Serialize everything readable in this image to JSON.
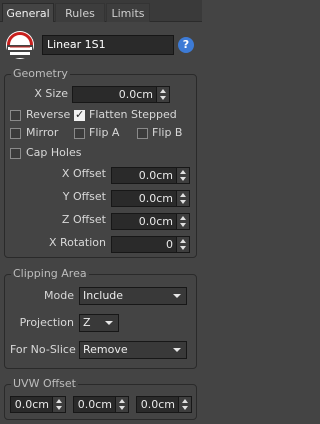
{
  "tabs": [
    {
      "label": "General",
      "active": true
    },
    {
      "label": "Rules",
      "active": false
    },
    {
      "label": "Limits",
      "active": false
    }
  ],
  "header": {
    "name_value": "Linear 1S1",
    "help_label": "?",
    "logo_icon": "slicer-logo-icon"
  },
  "geometry": {
    "title": "Geometry",
    "x_size_label": "X Size",
    "x_size_value": "0.0cm",
    "reverse_label": "Reverse",
    "reverse_checked": false,
    "flatten_label": "Flatten Stepped",
    "flatten_checked": true,
    "mirror_label": "Mirror",
    "mirror_checked": false,
    "flip_a_label": "Flip A",
    "flip_a_checked": false,
    "flip_b_label": "Flip B",
    "flip_b_checked": false,
    "cap_holes_label": "Cap Holes",
    "cap_holes_checked": false,
    "x_offset_label": "X Offset",
    "x_offset_value": "0.0cm",
    "y_offset_label": "Y Offset",
    "y_offset_value": "0.0cm",
    "z_offset_label": "Z Offset",
    "z_offset_value": "0.0cm",
    "x_rotation_label": "X Rotation",
    "x_rotation_value": "0"
  },
  "clipping": {
    "title": "Clipping Area",
    "mode_label": "Mode",
    "mode_value": "Include",
    "projection_label": "Projection",
    "projection_value": "Z",
    "noslice_label": "For No-Slice",
    "noslice_value": "Remove"
  },
  "uvw": {
    "title": "UVW Offset",
    "values": [
      "0.0cm",
      "0.0cm",
      "0.0cm"
    ]
  },
  "colors": {
    "panel_bg": "#444444",
    "field_bg": "#2a2a2a",
    "help_blue": "#3d7bd6",
    "logo_red": "#c8201e"
  }
}
